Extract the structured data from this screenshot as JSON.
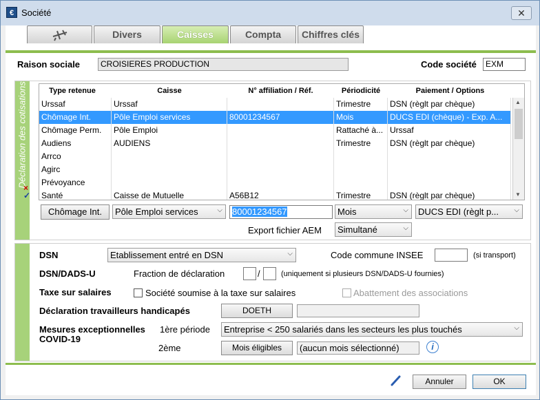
{
  "window": {
    "title": "Société",
    "app_icon": "€"
  },
  "tabs": [
    "Divers",
    "Caisses",
    "Compta",
    "Chiffres clés"
  ],
  "header": {
    "raison_label": "Raison sociale",
    "raison_value": "CROISIERES PRODUCTION",
    "code_label": "Code société",
    "code_value": "EXM"
  },
  "cotisations": {
    "sidebar_title": "Déclaration des cotisations",
    "columns": [
      "Type retenue",
      "Caisse",
      "N° affiliation / Réf.",
      "Périodicité",
      "Paiement / Options"
    ],
    "rows": [
      [
        "Urssaf",
        "Urssaf",
        "",
        "Trimestre",
        "DSN (règlt par chèque)"
      ],
      [
        "Chômage Int.",
        "Pôle Emploi services",
        "80001234567",
        "Mois",
        "DUCS EDI (chèque) - Exp. A..."
      ],
      [
        "Chômage Perm.",
        "Pôle Emploi",
        "",
        "Rattaché à...",
        "Urssaf"
      ],
      [
        "Audiens",
        "AUDIENS",
        "",
        "Trimestre",
        "DSN (règlt par chèque)"
      ],
      [
        "Arrco",
        "",
        "",
        "",
        ""
      ],
      [
        "Agirc",
        "",
        "",
        "",
        ""
      ],
      [
        "Prévoyance",
        "",
        "",
        "",
        ""
      ],
      [
        "Santé",
        "Caisse de Mutuelle",
        "A56B12",
        "Trimestre",
        "DSN (règlt par chèque)"
      ]
    ],
    "selected_row": 1,
    "edit": {
      "type": "Chômage Int.",
      "caisse": "Pôle Emploi services",
      "affiliation": "80001234567",
      "periodicite": "Mois",
      "paiement": "DUCS EDI (règlt p..."
    },
    "export_label": "Export fichier AEM",
    "export_value": "Simultané",
    "delete_mark": "×",
    "validate_mark": "✓"
  },
  "dsn": {
    "dsn_label": "DSN",
    "dsn_value": "Etablissement entré en DSN",
    "insee_label": "Code commune INSEE",
    "insee_value": "",
    "insee_note": "(si transport)",
    "dads_label": "DSN/DADS-U",
    "fraction_label": "Fraction de déclaration",
    "fraction_num": "",
    "fraction_sep": "/",
    "fraction_den": "",
    "fraction_note": "(uniquement si plusieurs DSN/DADS-U fournies)",
    "taxe_label": "Taxe sur salaires",
    "taxe_check": "Société soumise à la taxe sur salaires",
    "abattement_check": "Abattement des associations",
    "handicap_label": "Déclaration travailleurs handicapés",
    "doeth_button": "DOETH",
    "doeth_value": "",
    "covid_label_1": "Mesures exceptionnelles",
    "covid_label_2": "COVID-19",
    "periode1_label": "1ère période",
    "periode1_value": "Entreprise < 250 salariés dans les secteurs les plus touchés",
    "periode2_label": "2ème",
    "mois_button": "Mois éligibles",
    "mois_value": "(aucun mois sélectionné)",
    "info": "i"
  },
  "footer": {
    "cancel": "Annuler",
    "ok": "OK"
  }
}
